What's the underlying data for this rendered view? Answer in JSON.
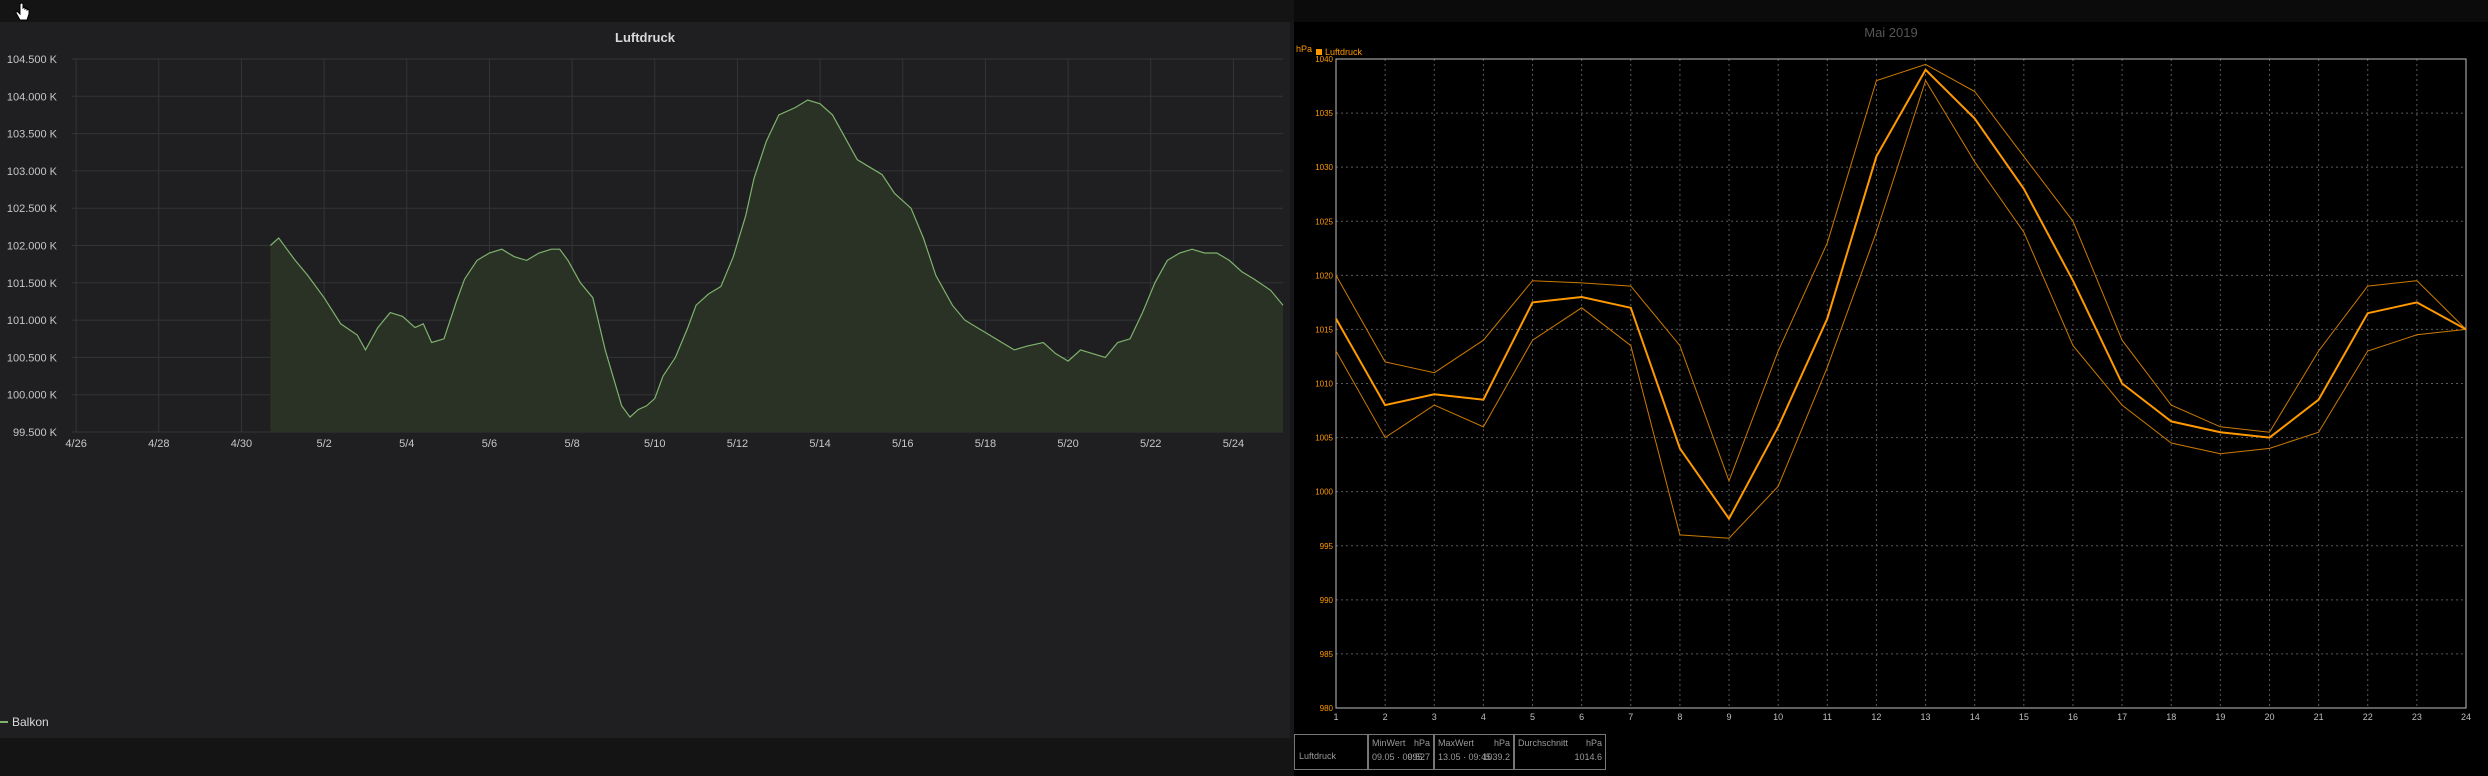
{
  "left_panel": {
    "title": "Luftdruck",
    "legend": "Balkon",
    "colors": {
      "line": "#7eb26d",
      "fill": "#2b3326",
      "grid": "#333436",
      "text": "#c7c7c7"
    }
  },
  "right_panel": {
    "title": "Mai 2019",
    "unit": "hPa",
    "legend": "Luftdruck",
    "colors": {
      "accent": "#ff9900",
      "thin": "#cc7a00",
      "grid": "#5a5a5a",
      "axis": "#bfbfbf"
    },
    "stats": {
      "row_label": "Luftdruck",
      "min_label": "MinWert",
      "min_unit": "hPa",
      "min_time": "09.05 · 00:52",
      "min_value": "995.7",
      "max_label": "MaxWert",
      "max_unit": "hPa",
      "max_time": "13.05 · 09:45",
      "max_value": "1039.2",
      "avg_label": "Durchschnitt",
      "avg_unit": "hPa",
      "avg_value": "1014.6"
    }
  },
  "chart_data": [
    {
      "type": "area",
      "title": "Luftdruck",
      "ylim": [
        99500,
        104500
      ],
      "y_ticks": [
        "99.500 K",
        "100.000 K",
        "100.500 K",
        "101.000 K",
        "101.500 K",
        "102.000 K",
        "102.500 K",
        "103.000 K",
        "103.500 K",
        "104.000 K",
        "104.500 K"
      ],
      "x_ticks": [
        "4/26",
        "4/28",
        "4/30",
        "5/2",
        "5/4",
        "5/6",
        "5/8",
        "5/10",
        "5/12",
        "5/14",
        "5/16",
        "5/18",
        "5/20",
        "5/22",
        "5/24"
      ],
      "xlim_days": [
        -0.1,
        29.2
      ],
      "series": [
        {
          "name": "Balkon",
          "x": [
            4.7,
            4.9,
            5.1,
            5.3,
            5.6,
            6.0,
            6.4,
            6.8,
            7.0,
            7.3,
            7.6,
            7.9,
            8.2,
            8.4,
            8.6,
            8.9,
            9.2,
            9.4,
            9.7,
            10.0,
            10.3,
            10.6,
            10.9,
            11.2,
            11.5,
            11.7,
            11.9,
            12.2,
            12.5,
            12.8,
            13.2,
            13.4,
            13.6,
            13.8,
            14.0,
            14.2,
            14.5,
            14.8,
            15.0,
            15.3,
            15.6,
            15.9,
            16.2,
            16.4,
            16.7,
            17.0,
            17.4,
            17.7,
            18.0,
            18.3,
            18.6,
            18.9,
            19.2,
            19.5,
            19.8,
            20.2,
            20.5,
            20.8,
            21.2,
            21.5,
            21.8,
            22.1,
            22.4,
            22.7,
            23.0,
            23.4,
            23.7,
            24.0,
            24.3,
            24.6,
            24.9,
            25.2,
            25.5,
            25.8,
            26.1,
            26.4,
            26.7,
            27.0,
            27.3,
            27.6,
            27.9,
            28.2,
            28.5,
            28.9,
            29.2
          ],
          "values": [
            102000,
            102100,
            101950,
            101800,
            101600,
            101300,
            100950,
            100800,
            100600,
            100900,
            101100,
            101050,
            100900,
            100950,
            100700,
            100750,
            101250,
            101550,
            101800,
            101900,
            101950,
            101850,
            101800,
            101900,
            101950,
            101950,
            101800,
            101500,
            101300,
            100600,
            99850,
            99700,
            99800,
            99850,
            99950,
            100250,
            100500,
            100900,
            101200,
            101350,
            101450,
            101850,
            102400,
            102900,
            103400,
            103750,
            103850,
            103950,
            103900,
            103750,
            103450,
            103150,
            103050,
            102950,
            102700,
            102500,
            102100,
            101600,
            101200,
            101000,
            100900,
            100800,
            100700,
            100600,
            100650,
            100700,
            100550,
            100450,
            100600,
            100550,
            100500,
            100700,
            100750,
            101100,
            101500,
            101800,
            101900,
            101950,
            101900,
            101900,
            101800,
            101650,
            101550,
            101400,
            101200
          ]
        }
      ]
    },
    {
      "type": "line",
      "title": "Mai 2019",
      "ylabel": "hPa",
      "ylim": [
        980,
        1040
      ],
      "y_ticks": [
        980,
        985,
        990,
        995,
        1000,
        1005,
        1010,
        1015,
        1020,
        1025,
        1030,
        1035,
        1040
      ],
      "categories": [
        1,
        2,
        3,
        4,
        5,
        6,
        7,
        8,
        9,
        10,
        11,
        12,
        13,
        14,
        15,
        16,
        17,
        18,
        19,
        20,
        21,
        22,
        23,
        24
      ],
      "series": [
        {
          "name": "Luftdruck",
          "values": [
            1016,
            1008,
            1009,
            1008.5,
            1017.5,
            1018,
            1017,
            1004,
            997.5,
            1006,
            1016,
            1031,
            1039,
            1034.5,
            1028,
            1019.5,
            1010,
            1006.5,
            1005.5,
            1005,
            1008.5,
            1016.5,
            1017.5,
            1015
          ]
        },
        {
          "values": [
            1020,
            1012,
            1011,
            1014,
            1019.5,
            1019.3,
            1019,
            1013.5,
            1001,
            1013,
            1023,
            1038,
            1039.5,
            1037,
            1031,
            1025,
            1014,
            1008,
            1006,
            1005.5,
            1013,
            1019,
            1019.5,
            1015
          ]
        },
        {
          "values": [
            1013,
            1005,
            1008,
            1006,
            1014,
            1017,
            1013.5,
            996,
            995.7,
            1000.5,
            1011.5,
            1024,
            1038,
            1030.5,
            1024,
            1013.5,
            1008,
            1004.5,
            1003.5,
            1004,
            1005.5,
            1013,
            1014.5,
            1015
          ]
        }
      ]
    }
  ]
}
